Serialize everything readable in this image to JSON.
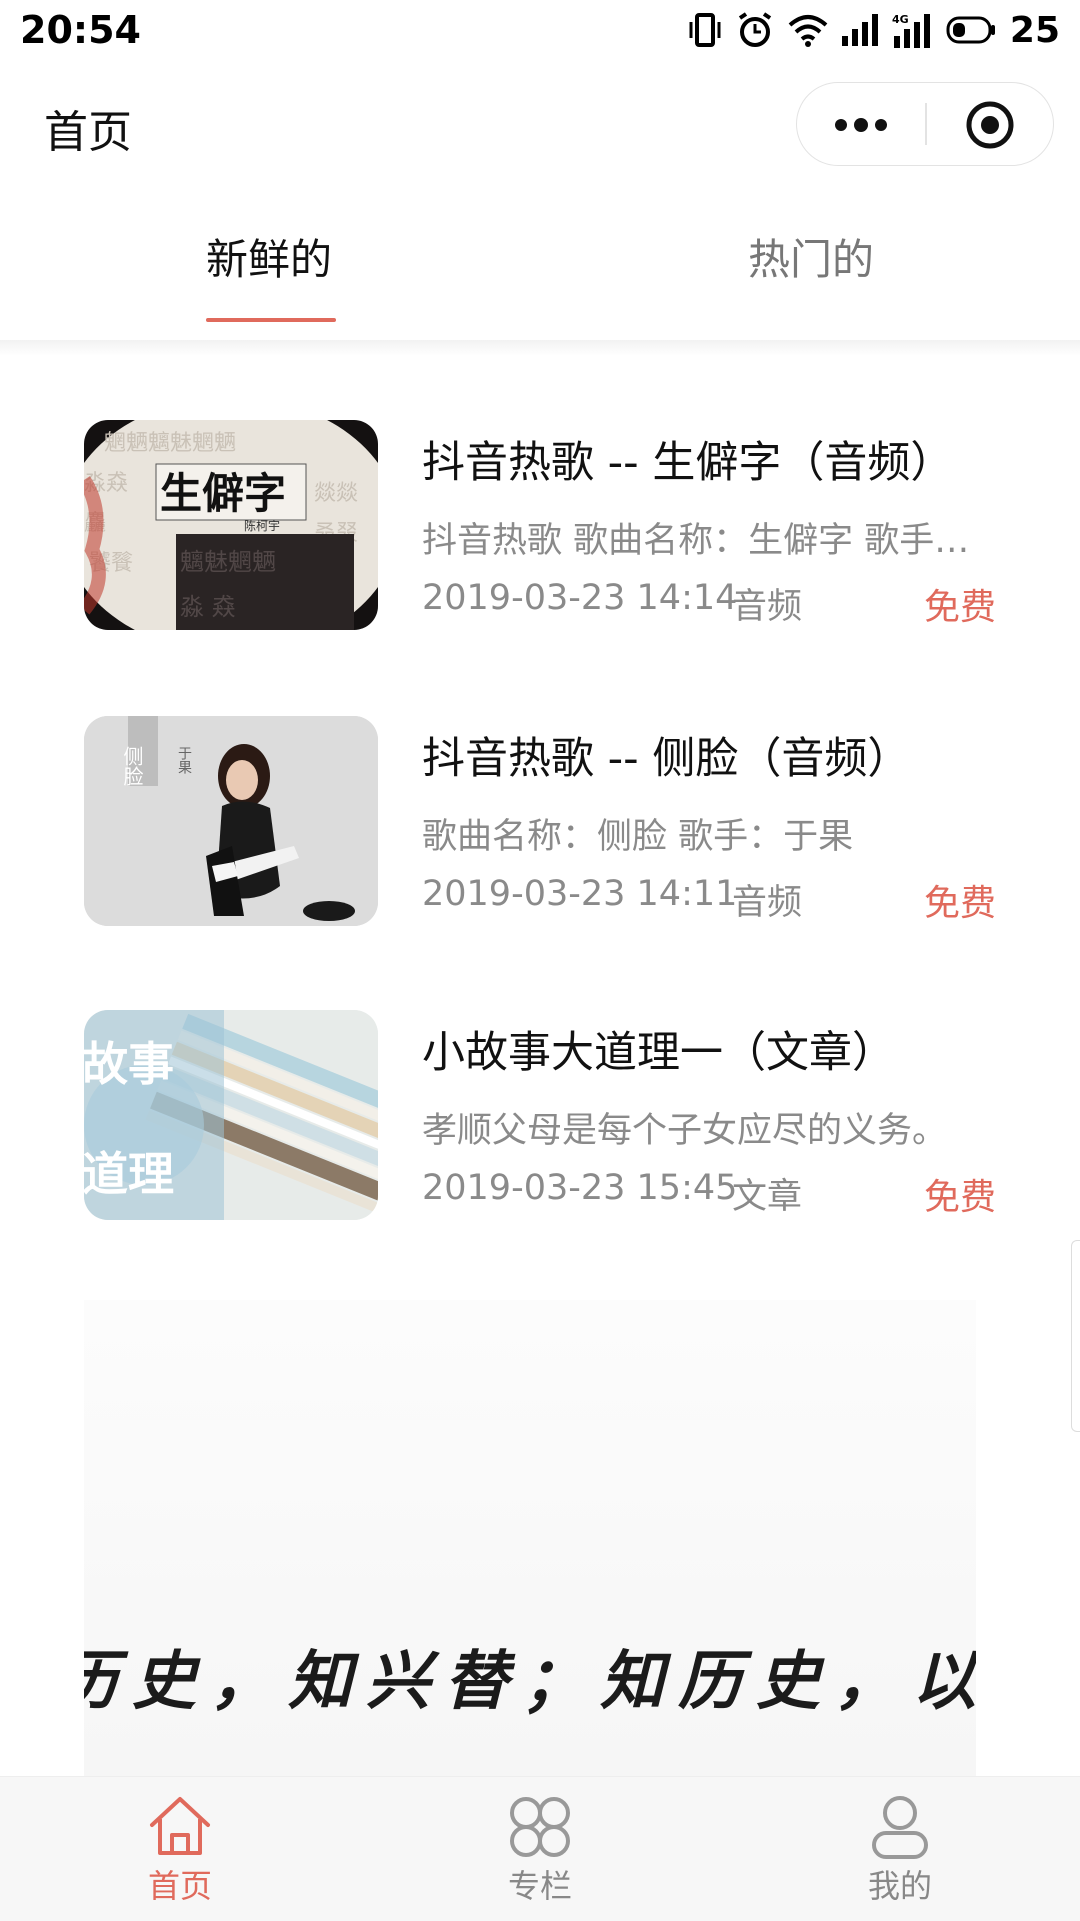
{
  "status_bar": {
    "time": "20:54",
    "battery": "25"
  },
  "header": {
    "title": "首页"
  },
  "tabs": [
    {
      "label": "新鲜的",
      "active": true
    },
    {
      "label": "热门的",
      "active": false
    }
  ],
  "items": [
    {
      "title": "抖音热歌 -- 生僻字（音频）",
      "desc": "抖音热歌 歌曲名称：生僻字 歌手…",
      "date": "2019-03-23 14:14",
      "type": "音频",
      "price": "免费",
      "thumb_text": "生僻字",
      "thumb_sub": "陈柯宇"
    },
    {
      "title": "抖音热歌 -- 侧脸（音频）",
      "desc": "歌曲名称：侧脸  歌手：于果",
      "date": "2019-03-23 14:11",
      "type": "音频",
      "price": "免费",
      "thumb_text": "侧脸",
      "thumb_sub": "于果"
    },
    {
      "title": "小故事大道理一（文章）",
      "desc": "孝顺父母是每个子女应尽的义务。",
      "date": "2019-03-23 15:45",
      "type": "文章",
      "price": "免费",
      "thumb_text": "故事",
      "thumb_sub": "道理"
    }
  ],
  "banner": {
    "text": "历史，知兴替；知历史，以明"
  },
  "tabbar": [
    {
      "label": "首页",
      "icon": "home-icon",
      "active": true
    },
    {
      "label": "专栏",
      "icon": "grid-icon",
      "active": false
    },
    {
      "label": "我的",
      "icon": "user-icon",
      "active": false
    }
  ],
  "colors": {
    "accent": "#e06a5c",
    "muted": "#8a8a8a"
  }
}
